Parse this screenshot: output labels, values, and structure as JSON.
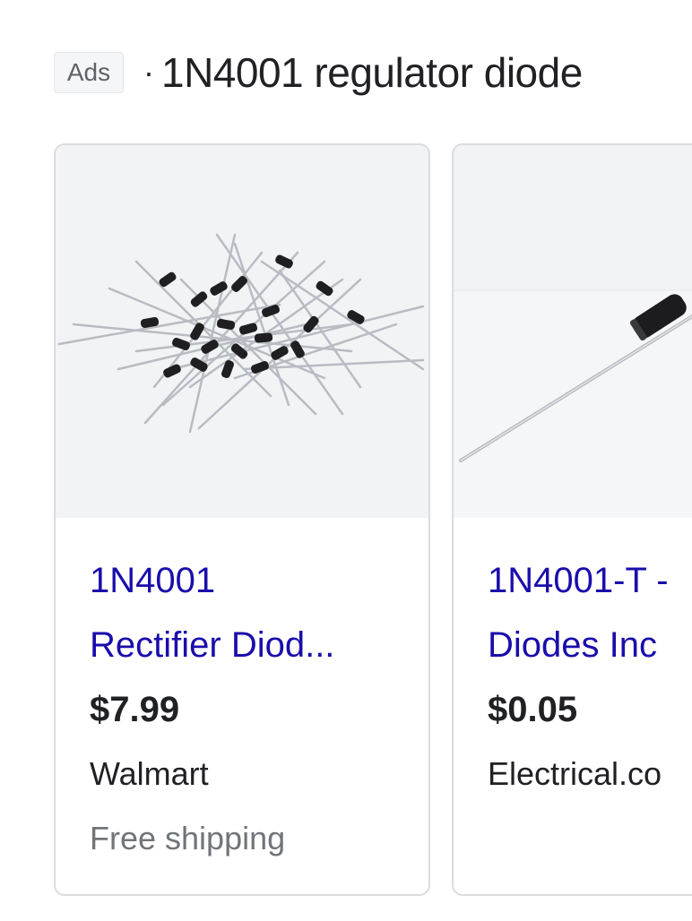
{
  "header": {
    "ads_label": "Ads",
    "separator": "·",
    "query": "1N4001 regulator diode"
  },
  "products": [
    {
      "title_line1": "1N4001",
      "title_line2": "Rectifier Diod...",
      "price": "$7.99",
      "merchant": "Walmart",
      "shipping": "Free shipping",
      "image": "pile-of-diodes-image"
    },
    {
      "title_line1": "1N4001-T -",
      "title_line2": "Diodes Inc",
      "price": "$0.05",
      "merchant": "Electrical.co",
      "image": "single-diode-image"
    }
  ],
  "colors": {
    "link": "#1a0dab",
    "text": "#202124",
    "muted": "#70757a",
    "thumb_bg": "#f1f3f5",
    "border": "#dadce0"
  }
}
